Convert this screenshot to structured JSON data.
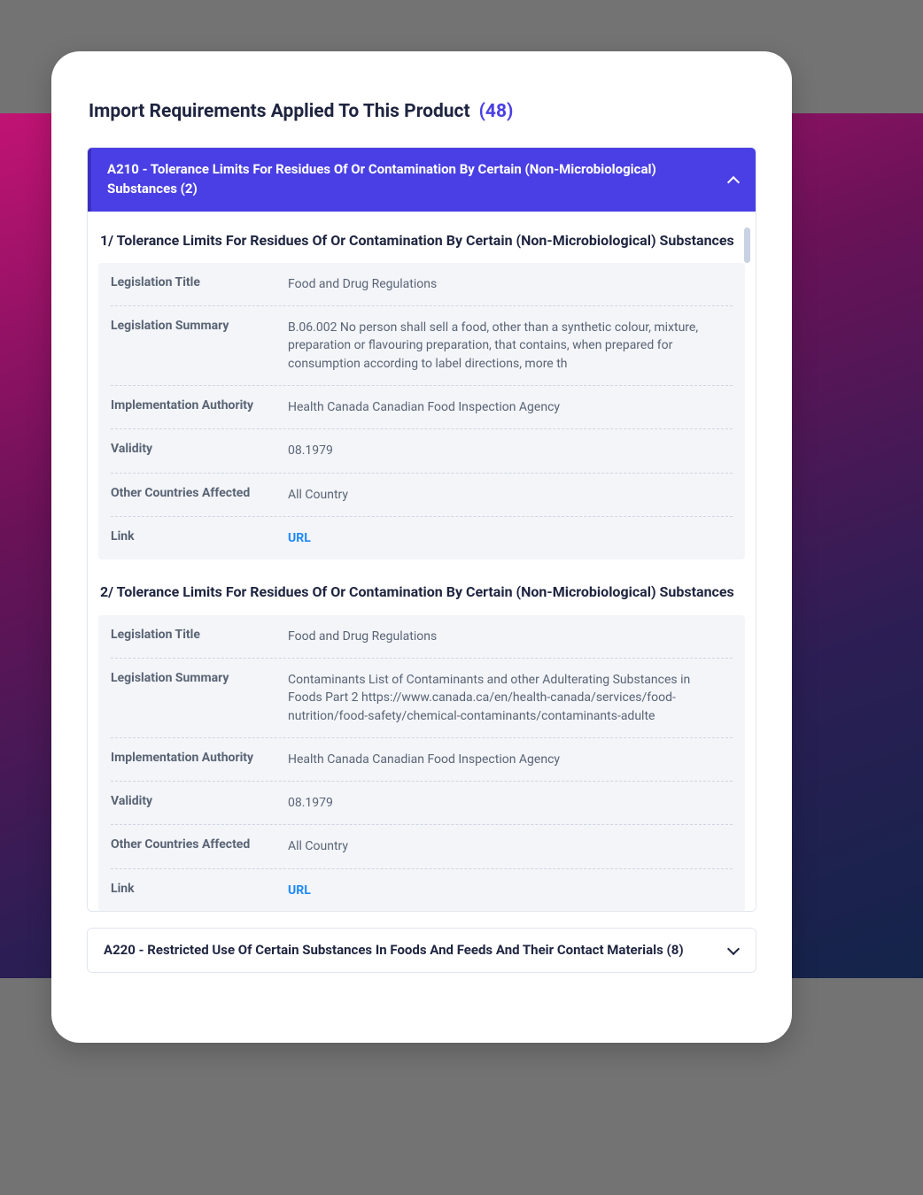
{
  "header": {
    "title": "Import Requirements Applied To This Product",
    "count": "(48)"
  },
  "panels": [
    {
      "expanded": true,
      "header_label": "A210 -  Tolerance Limits For Residues Of Or Contamination By Certain (Non-Microbiological) Substances (2)",
      "items": [
        {
          "title": "1/ Tolerance Limits For Residues Of Or Contamination By Certain (Non-Microbiological) Substances",
          "rows": [
            {
              "k": "Legislation Title",
              "v": "Food and Drug Regulations"
            },
            {
              "k": "Legislation Summary",
              "v": "B.06.002 No person shall sell a food, other than a synthetic colour, mixture, preparation or flavouring preparation, that contains, when prepared for consumption according to label directions, more th"
            },
            {
              "k": "Implementation Authority",
              "v": "Health Canada Canadian Food Inspection Agency"
            },
            {
              "k": "Validity",
              "v": "08.1979"
            },
            {
              "k": "Other Countries Affected",
              "v": "All Country"
            },
            {
              "k": "Link",
              "v": "URL",
              "link": true
            }
          ]
        },
        {
          "title": "2/ Tolerance Limits For Residues Of Or Contamination By Certain (Non-Microbiological) Substances",
          "rows": [
            {
              "k": "Legislation Title",
              "v": "Food and Drug Regulations"
            },
            {
              "k": "Legislation Summary",
              "v": "Contaminants List of Contaminants and other Adulterating Substances in Foods Part 2 https://www.canada.ca/en/health-canada/services/food-nutrition/food-safety/chemical-contaminants/contaminants-adulte"
            },
            {
              "k": "Implementation Authority",
              "v": "Health Canada Canadian Food Inspection Agency"
            },
            {
              "k": "Validity",
              "v": "08.1979"
            },
            {
              "k": "Other Countries Affected",
              "v": "All Country"
            },
            {
              "k": "Link",
              "v": "URL",
              "link": true
            }
          ]
        }
      ]
    },
    {
      "expanded": false,
      "header_label": "A220 -  Restricted Use Of Certain Substances In Foods And Feeds And Their Contact Materials (8)"
    }
  ]
}
